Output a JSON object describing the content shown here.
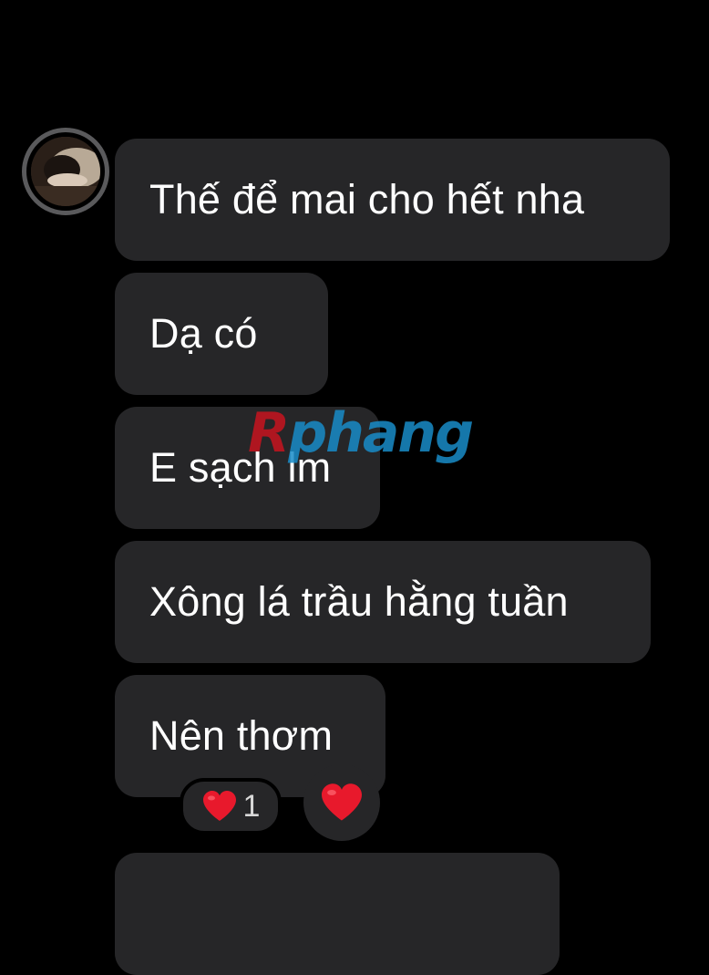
{
  "conversation": {
    "messages": [
      {
        "text": "Thế để mai cho hết nha"
      },
      {
        "text": "Dạ có"
      },
      {
        "text": "E sạch lm"
      },
      {
        "text": "Xông lá trầu hằng tuần"
      },
      {
        "text": "Nên thơm"
      },
      {
        "text": ""
      }
    ],
    "reaction": {
      "emoji_icon": "heart-icon",
      "count": "1"
    },
    "react_button_icon": "heart-icon"
  },
  "watermark": {
    "first": "R",
    "rest": "phang"
  },
  "colors": {
    "background": "#000000",
    "bubble": "#262628",
    "heart": "#e8192c",
    "avatar_ring": "#5a5a5c"
  }
}
